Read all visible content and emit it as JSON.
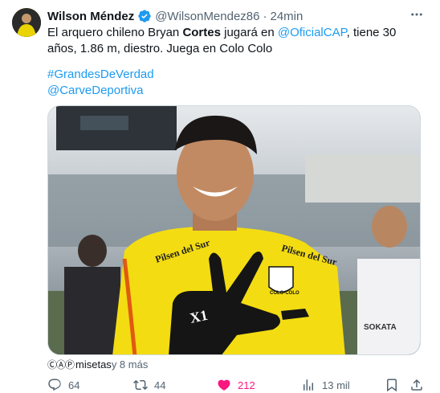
{
  "author": {
    "name": "Wilson Méndez",
    "handle": "@WilsonMendez86",
    "separator": "·",
    "time": "24min",
    "verified": true
  },
  "tweet": {
    "text_before": "El arquero chileno Bryan ",
    "text_bold": "Cortes",
    "text_mid": " jugará en ",
    "mention": "@OficialCAP",
    "text_after": ", tiene 30 años, 1.86 m, diestro. Juega en Colo Colo",
    "hashtag": "#GrandesDeVerdad",
    "mention2": "@CarveDeportiva"
  },
  "media": {
    "shirt_text_left": "Pilsen del Sur",
    "shirt_text_right": "Pilsen del Sur",
    "glove_text": "X1",
    "crest_text": "COLO-COLO",
    "teammate_shirt_text": "SOKATA"
  },
  "tagged": {
    "icons": "ⒸⒶⓅ",
    "user": "misetas",
    "more": " y 8 más"
  },
  "actions": {
    "replies": "64",
    "retweets": "44",
    "likes": "212",
    "views": "13 mil"
  },
  "colors": {
    "accent": "#1d9bf0",
    "like": "#f91880",
    "muted": "#536471"
  },
  "icons": [
    "verified-badge-icon",
    "more-icon",
    "reply-icon",
    "retweet-icon",
    "heart-icon",
    "views-icon",
    "bookmark-icon",
    "share-icon"
  ]
}
